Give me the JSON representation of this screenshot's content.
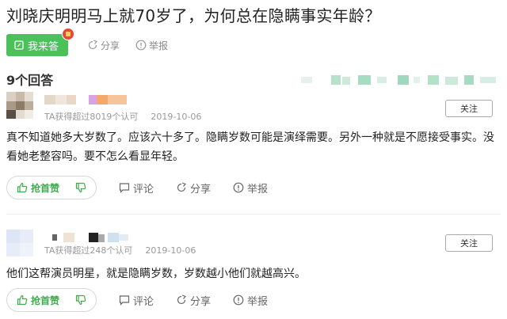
{
  "question": {
    "title": "刘晓庆明明马上就70岁了，为何总在隐瞒事实年龄？",
    "answer_button": "我来答",
    "share": "分享",
    "report": "举报"
  },
  "answers_count": "9个回答",
  "answers": [
    {
      "meta_text": "TA获得超过8019个认可",
      "date": "2019-10-06",
      "follow": "关注",
      "content": "真不知道她多大岁数了。应该六十多了。隐瞒岁数可能是演绎需要。另外一种就是不愿接受事实。没看她老整容吗。要不怎么看显年轻。",
      "like": "抢首赞",
      "comment": "评论",
      "share": "分享",
      "report": "举报"
    },
    {
      "meta_text": "TA获得超过248个认可",
      "date": "2019-10-06",
      "follow": "关注",
      "content": "他们这帮演员明星，就是隐瞒岁数，岁数越小他们就越高兴。",
      "like": "抢首赞",
      "comment": "评论",
      "share": "分享",
      "report": "举报"
    }
  ],
  "colors": {
    "accent_green": "#4cc15a",
    "like_green": "#3daa4b",
    "red_packet": "#e8463a",
    "meta_gray": "#999999"
  }
}
